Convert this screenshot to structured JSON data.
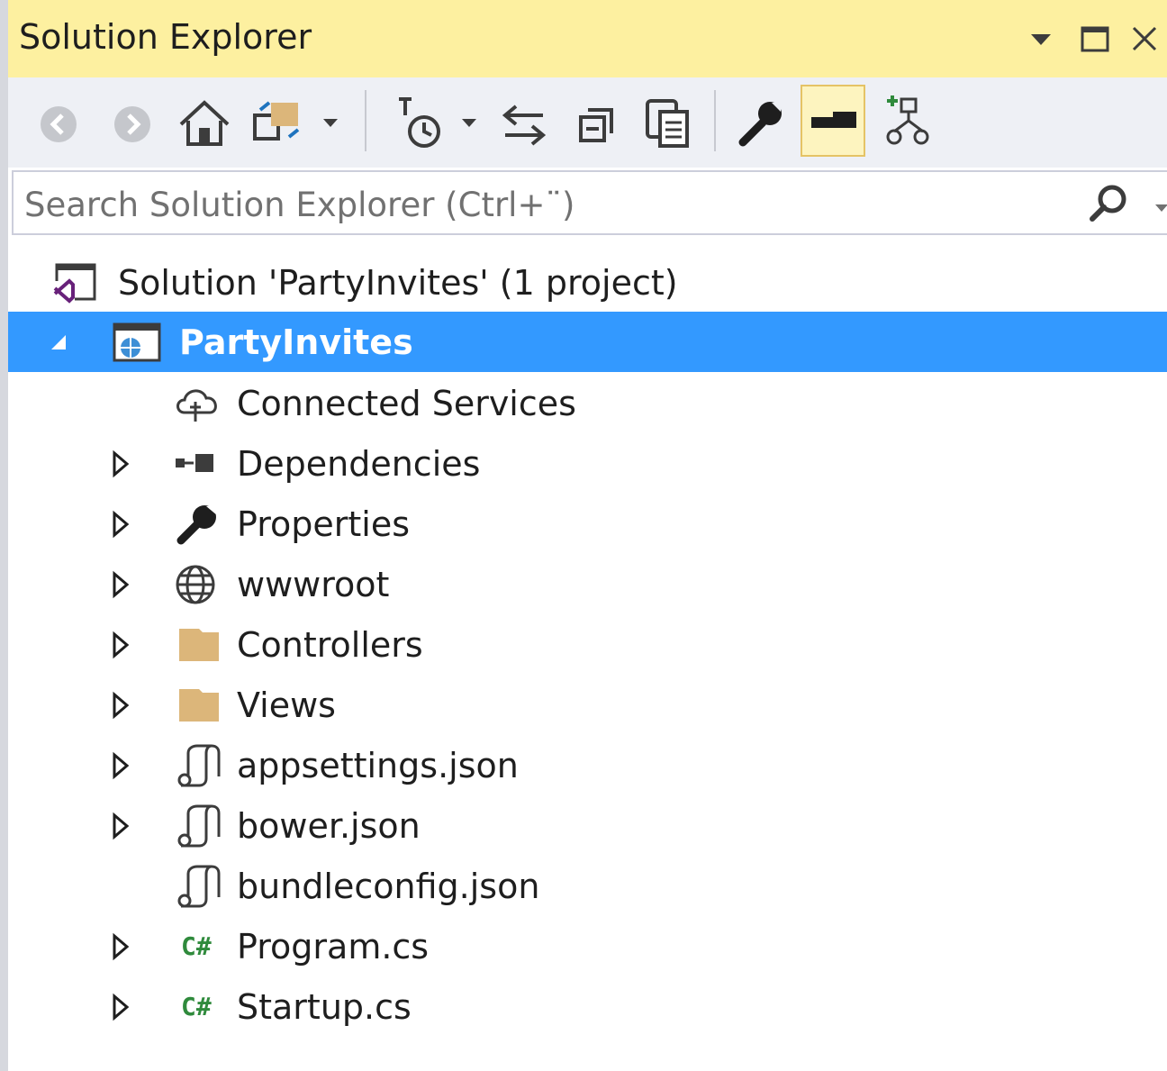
{
  "window": {
    "title": "Solution Explorer"
  },
  "search": {
    "placeholder": "Search Solution Explorer (Ctrl+¨)"
  },
  "toolbar": {
    "buttons": [
      {
        "name": "back-icon"
      },
      {
        "name": "forward-icon"
      },
      {
        "name": "home-icon"
      },
      {
        "name": "switch-views-icon"
      },
      {
        "name": "pending-changes-filter-icon"
      },
      {
        "name": "sync-active-document-icon"
      },
      {
        "name": "collapse-all-icon"
      },
      {
        "name": "show-all-files-icon"
      },
      {
        "name": "properties-icon"
      },
      {
        "name": "preview-selected-items-icon"
      },
      {
        "name": "view-class-diagram-icon"
      }
    ]
  },
  "tree": {
    "solution": "Solution 'PartyInvites' (1 project)",
    "project": "PartyInvites",
    "items": [
      {
        "label": "Connected Services",
        "icon": "cloud-connected-icon",
        "expandable": false
      },
      {
        "label": "Dependencies",
        "icon": "dependencies-icon",
        "expandable": true
      },
      {
        "label": "Properties",
        "icon": "wrench-icon",
        "expandable": true
      },
      {
        "label": "wwwroot",
        "icon": "globe-icon",
        "expandable": true
      },
      {
        "label": "Controllers",
        "icon": "folder-icon",
        "expandable": true
      },
      {
        "label": "Views",
        "icon": "folder-icon",
        "expandable": true
      },
      {
        "label": "appsettings.json",
        "icon": "json-file-icon",
        "expandable": true
      },
      {
        "label": "bower.json",
        "icon": "json-file-icon",
        "expandable": true
      },
      {
        "label": "bundleconfig.json",
        "icon": "json-file-icon",
        "expandable": false
      },
      {
        "label": "Program.cs",
        "icon": "csharp-file-icon",
        "expandable": true
      },
      {
        "label": "Startup.cs",
        "icon": "csharp-file-icon",
        "expandable": true
      }
    ],
    "csharp_glyph": "C#"
  },
  "colors": {
    "title_bar": "#fdf0a0",
    "toolbar": "#eef0f5",
    "selection": "#3399ff",
    "folder": "#dcb67a",
    "csharp": "#2f8a3c"
  }
}
